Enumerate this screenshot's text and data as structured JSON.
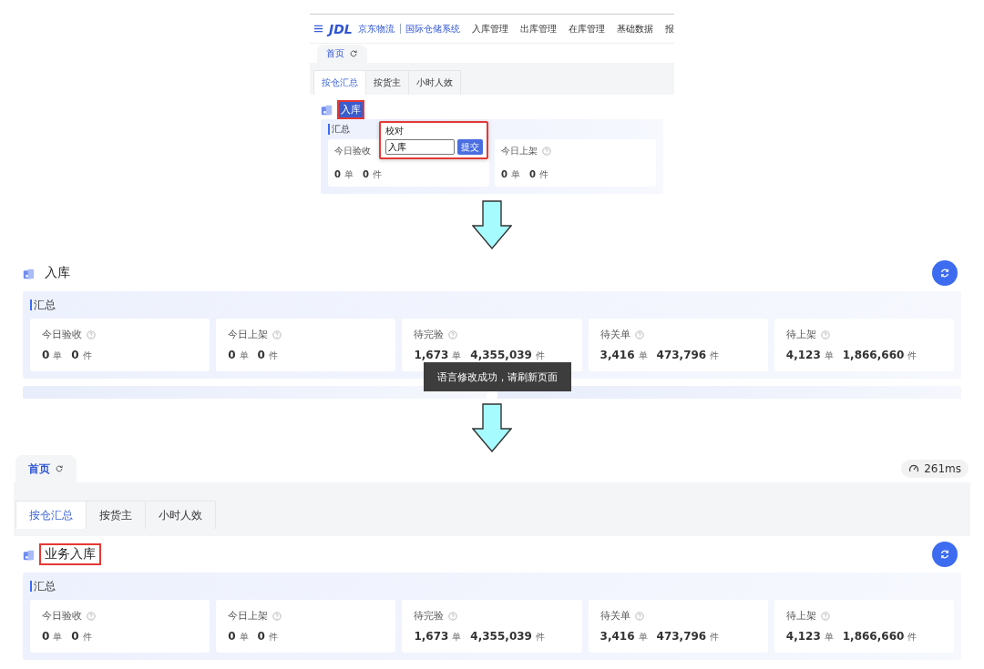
{
  "steps": [
    {
      "kind": "edit",
      "nav": {
        "logo_mark": "JDL",
        "brand": "京东物流",
        "system": "国际仓储系统",
        "menu": [
          "入库管理",
          "出库管理",
          "在库管理",
          "基础数据",
          "报"
        ]
      },
      "page_tab": {
        "label": "首页",
        "selected": true
      },
      "tabs": [
        {
          "label": "按仓汇总",
          "selected": true
        },
        {
          "label": "按货主",
          "selected": false
        },
        {
          "label": "小时人效",
          "selected": false
        }
      ],
      "section_title": {
        "text": "入库",
        "marked": true,
        "text_selected": true
      },
      "summary_label": "汇总",
      "popover": {
        "title": "校对",
        "input_value": "入库",
        "button": "提交",
        "marked": true
      },
      "cards": [
        {
          "title": "今日验收",
          "help": false,
          "orders": "0",
          "order_unit": "单",
          "items": "0",
          "item_unit": "件"
        },
        {
          "title": "今日上架",
          "help": true,
          "orders": "0",
          "order_unit": "单",
          "items": "0",
          "item_unit": "件"
        }
      ]
    },
    {
      "kind": "toast",
      "section_title": {
        "text": "入库",
        "marked": false,
        "text_selected": false
      },
      "summary_label": "汇总",
      "cards": [
        {
          "title": "今日验收",
          "help": true,
          "orders": "0",
          "order_unit": "单",
          "items": "0",
          "item_unit": "件"
        },
        {
          "title": "今日上架",
          "help": true,
          "orders": "0",
          "order_unit": "单",
          "items": "0",
          "item_unit": "件"
        },
        {
          "title": "待完验",
          "help": true,
          "orders": "1,673",
          "order_unit": "单",
          "items": "4,355,039",
          "item_unit": "件"
        },
        {
          "title": "待关单",
          "help": true,
          "orders": "3,416",
          "order_unit": "单",
          "items": "473,796",
          "item_unit": "件"
        },
        {
          "title": "待上架",
          "help": true,
          "orders": "4,123",
          "order_unit": "单",
          "items": "1,866,660",
          "item_unit": "件"
        }
      ],
      "toast": "语言修改成功，请刷新页面"
    },
    {
      "kind": "result",
      "page_tab": {
        "label": "首页",
        "selected": true
      },
      "response_time": "261ms",
      "tabs": [
        {
          "label": "按仓汇总",
          "selected": true
        },
        {
          "label": "按货主",
          "selected": false
        },
        {
          "label": "小时人效",
          "selected": false
        }
      ],
      "section_title": {
        "text": "业务入库",
        "marked": true,
        "text_selected": false
      },
      "summary_label": "汇总",
      "cards": [
        {
          "title": "今日验收",
          "help": true,
          "orders": "0",
          "order_unit": "单",
          "items": "0",
          "item_unit": "件"
        },
        {
          "title": "今日上架",
          "help": true,
          "orders": "0",
          "order_unit": "单",
          "items": "0",
          "item_unit": "件"
        },
        {
          "title": "待完验",
          "help": true,
          "orders": "1,673",
          "order_unit": "单",
          "items": "4,355,039",
          "item_unit": "件"
        },
        {
          "title": "待关单",
          "help": true,
          "orders": "3,416",
          "order_unit": "单",
          "items": "473,796",
          "item_unit": "件"
        },
        {
          "title": "待上架",
          "help": true,
          "orders": "4,123",
          "order_unit": "单",
          "items": "1,866,660",
          "item_unit": "件"
        }
      ]
    }
  ]
}
